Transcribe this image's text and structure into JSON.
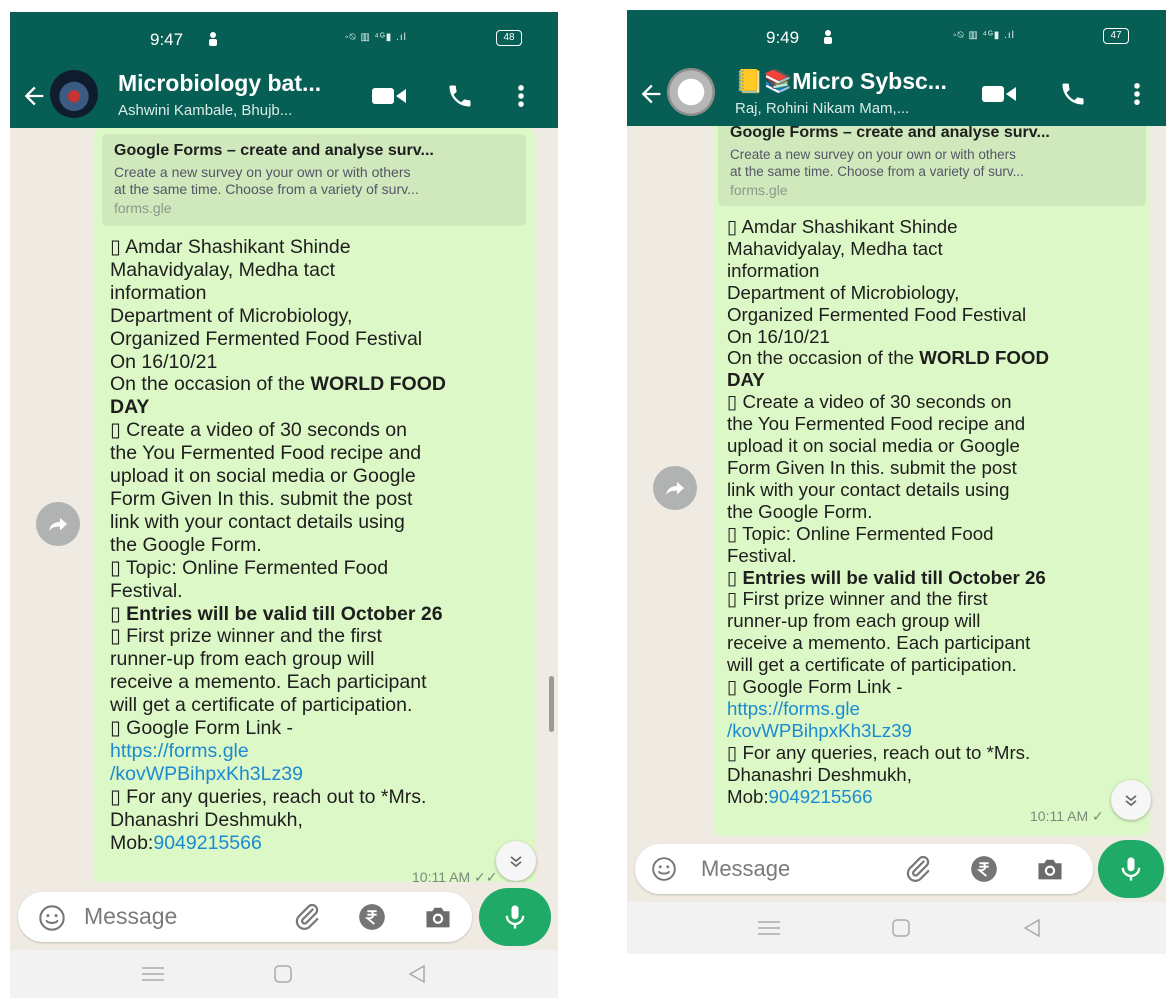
{
  "left": {
    "status": {
      "time": "9:47",
      "battery": "48"
    },
    "chat": {
      "title": "Microbiology bat...",
      "subtitle": "Ashwini Kambale, Bhujb..."
    },
    "time": "10:11 AM"
  },
  "right": {
    "status": {
      "time": "9:49",
      "battery": "47"
    },
    "chat": {
      "title_emoji": "📒📚",
      "title": "Micro Sybsc...",
      "subtitle": "Raj, Rohini Nikam Mam,..."
    },
    "time": "10:11 AM"
  },
  "preview": {
    "title": "Google Forms – create and analyse surv...",
    "desc_1": "Create a new survey on your own or with others",
    "desc_2": "at the same time. Choose from a variety of surv...",
    "domain": "forms.gle"
  },
  "message": {
    "bullet": "▯",
    "college_1": "Amdar Shashikant Shinde",
    "college_2": "Mahavidyalay, Medha tact",
    "college_3": "information",
    "dept": "Department of Microbiology,",
    "organized": "Organized Fermented Food Festival",
    "date": "On 16/10/21",
    "occasion_prefix": "On the occasion of the ",
    "occasion_bold_1": "WORLD FOOD",
    "occasion_bold_2": "DAY",
    "create_1": "Create a video of 30 seconds on",
    "create_2": "the You Fermented Food recipe and",
    "create_3": "upload it on social media or Google",
    "create_4": "Form Given In this. submit the post",
    "create_5": "link with your contact details using",
    "create_6": "the Google Form.",
    "topic_1": "Topic: Online Fermented Food",
    "topic_2": "Festival.",
    "entries": "Entries will be valid till October 26",
    "prize_1": "First prize winner and the first",
    "prize_2": "runner-up from each group will",
    "prize_3": "receive a memento. Each participant",
    "prize_4": "will get a certificate of participation.",
    "form_link_label": "Google Form Link -",
    "link_1": "https://forms.gle",
    "link_2": "/kovWPBihpxKh3Lz39",
    "queries": "For any queries, reach out to *Mrs.",
    "name": "Dhanashri Deshmukh,",
    "mob_prefix": "Mob:",
    "phone": "9049215566"
  },
  "input": {
    "placeholder": "Message"
  },
  "colors": {
    "header": "#075e54",
    "bubble": "#dcf8c6",
    "link": "#1b8ad1",
    "mic": "#1faa67"
  },
  "icons": [
    "back-arrow-icon",
    "video-call-icon",
    "voice-call-icon",
    "more-options-icon",
    "forward-icon",
    "scroll-down-icon",
    "emoji-icon",
    "attach-icon",
    "rupee-payment-icon",
    "camera-icon",
    "mic-icon",
    "menu-nav-icon",
    "home-nav-icon",
    "back-nav-icon"
  ]
}
